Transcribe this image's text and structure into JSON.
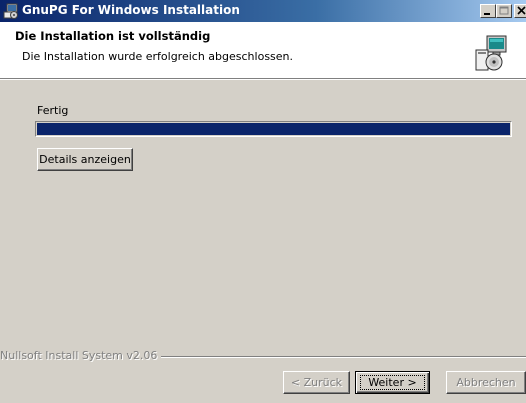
{
  "window": {
    "title": "GnuPG For Windows Installation"
  },
  "header": {
    "title": "Die Installation ist vollständig",
    "subtitle": "Die Installation wurde erfolgreich abgeschlossen."
  },
  "status": {
    "label": "Fertig",
    "progress_fraction": 1.0
  },
  "buttons": {
    "details": "Details anzeigen",
    "back": "< Zurück",
    "next": "Weiter >",
    "cancel": "Abbrechen"
  },
  "branding": "Nullsoft Install System v2.06",
  "icons": {
    "title": "installer-icon",
    "header": "computer-disk-icon"
  },
  "colors": {
    "progress": "#0a246a",
    "title_bar": "#0a246a"
  }
}
